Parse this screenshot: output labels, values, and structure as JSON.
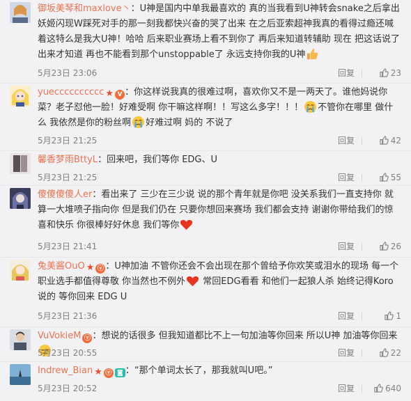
{
  "comments": [
    {
      "name": "御坂美琴和maxlove丶",
      "body1": "U神是国内中单我最喜欢的 真的当我看到U神转会snake之后拿出妖姬闪现W踩死对手的那一刻我都快兴奋的哭了出来 在之后亚索超神我真的看得过瘾还喊着这特么是我大U神！哈哈 后来职业赛场上看不到你了 再后来知道转辅助 现在 把这话说了出来才知道 再也不能看到那个unstoppable了 永远支持你我的U神",
      "time": "5月23日 23:06",
      "reply": "回复",
      "likes": "23"
    },
    {
      "name": "yuecccccccccc",
      "body1": "你这样说我真的很难过啊，喜欢你又不是一两天了。谁他妈说你菜？老子怼他一脸！好难受啊 你干嘛这样啊！！写这么多字！！！",
      "body2": "不管你在哪里 做什么 我依然是你的粉丝啊",
      "body3": "好难过啊 妈的 不说了",
      "time": "5月23日 21:25",
      "reply": "回复",
      "likes": "42"
    },
    {
      "name": "馨香梦雨BttyL",
      "body1": "回来吧，我们等你 EDG、U",
      "time": "5月23日 21:25",
      "reply": "回复",
      "likes": "55"
    },
    {
      "name": "傻傻傻傻人er",
      "body1": "看出来了 三少在三少说 说的那个青年就是你吧 没关系我们一直支持你 就算一大堆喷子指向你 但是我们仍在 只要你想回来赛场 我们都会支持 谢谢你带给我们的惊喜和快乐 你很棒好好休息 我们等你",
      "time": "5月23日 21:41",
      "reply": "回复",
      "likes": "26"
    },
    {
      "name": "兔美酱OuO",
      "vip": "ⓥ",
      "body1": "U神加油 不管你还会不会出现在那个曾给予你欢笑或泪水的现场 每一个职业选手都值得尊敬 你当然也不例外",
      "body2": "常回EDG看看 和他们一起狼人杀 始终记得Koro说的 等你回来 EDG U",
      "time": "5月23日 21:36",
      "reply": "回复",
      "likes": "1"
    },
    {
      "name": "VuVokieM",
      "vip": "ⓥ",
      "body1": "想说的话很多 但我知道都比不上一句加油等你回来 所以U神 加油等你回来",
      "time": "5月23日 20:55",
      "reply": "回复",
      "likes": "22"
    },
    {
      "name": "Indrew_Bian",
      "vip": "ⓥ",
      "body1": "“那个单词太长了，那我就叫U吧。”",
      "time": "5月23日 20:52",
      "reply": "回复",
      "likes": "640"
    }
  ],
  "colors": {
    "name": "#eb7350",
    "meta": "#808080",
    "bg": "#f2f2f5"
  }
}
